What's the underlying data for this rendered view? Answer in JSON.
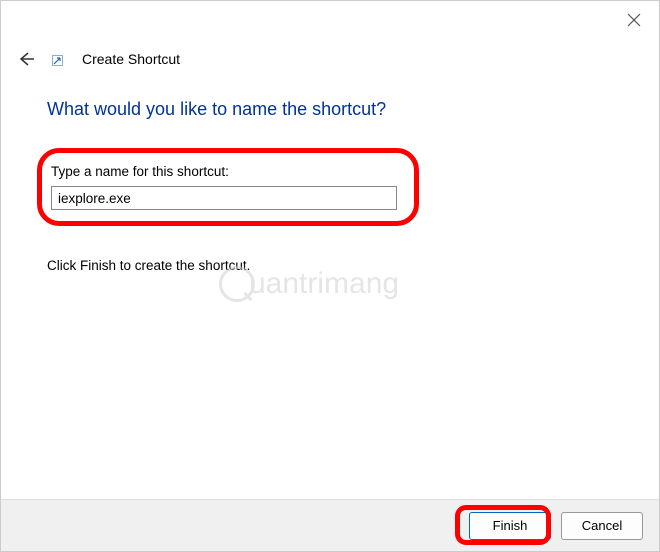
{
  "window": {
    "title": "Create Shortcut"
  },
  "content": {
    "question": "What would you like to name the shortcut?",
    "input_label": "Type a name for this shortcut:",
    "input_value": "iexplore.exe",
    "instruction": "Click Finish to create the shortcut."
  },
  "watermark": {
    "text": "uantrimang"
  },
  "footer": {
    "finish_label": "Finish",
    "cancel_label": "Cancel"
  }
}
